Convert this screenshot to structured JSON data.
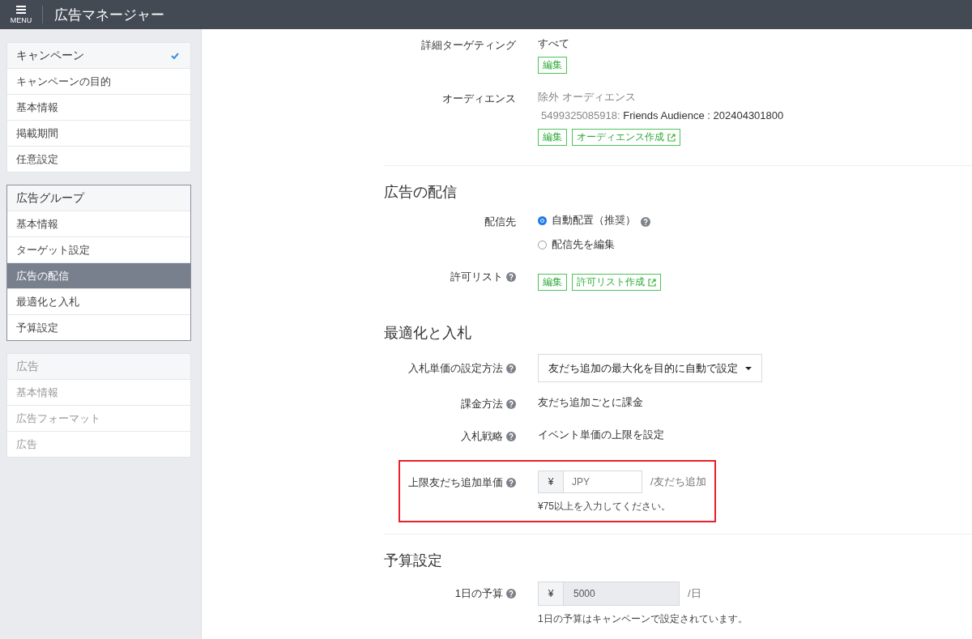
{
  "header": {
    "menu_label": "MENU",
    "title": "広告マネージャー"
  },
  "sidebar": {
    "groups": [
      {
        "title": "キャンペーン",
        "checked": true,
        "active": false,
        "disabled": false,
        "items": [
          {
            "label": "キャンペーンの目的",
            "selected": false
          },
          {
            "label": "基本情報",
            "selected": false
          },
          {
            "label": "掲載期間",
            "selected": false
          },
          {
            "label": "任意設定",
            "selected": false
          }
        ]
      },
      {
        "title": "広告グループ",
        "checked": false,
        "active": true,
        "disabled": false,
        "items": [
          {
            "label": "基本情報",
            "selected": false
          },
          {
            "label": "ターゲット設定",
            "selected": false
          },
          {
            "label": "広告の配信",
            "selected": true
          },
          {
            "label": "最適化と入札",
            "selected": false
          },
          {
            "label": "予算設定",
            "selected": false
          }
        ]
      },
      {
        "title": "広告",
        "checked": false,
        "active": false,
        "disabled": true,
        "items": [
          {
            "label": "基本情報",
            "selected": false
          },
          {
            "label": "広告フォーマット",
            "selected": false
          },
          {
            "label": "広告",
            "selected": false
          }
        ]
      }
    ]
  },
  "sections": [
    {
      "separated": false,
      "rows": [
        {
          "kind": "text",
          "label": "詳細ターゲティング",
          "help": false,
          "value": "すべて",
          "buttons": [
            {
              "label": "編集",
              "external": false
            }
          ]
        },
        {
          "kind": "audience",
          "label": "オーディエンス",
          "help": false,
          "muted_line": "除外 オーディエンス",
          "audience_id": "5499325085918:",
          "audience_name": "Friends Audience : 202404301800",
          "buttons": [
            {
              "label": "編集",
              "external": false
            },
            {
              "label": "オーディエンス作成",
              "external": true
            }
          ]
        }
      ]
    },
    {
      "separated": true,
      "heading": "広告の配信",
      "rows": [
        {
          "kind": "radio",
          "label": "配信先",
          "help": false,
          "options": [
            {
              "label": "自動配置（推奨）",
              "selected": true,
              "help": true
            },
            {
              "label": "配信先を編集",
              "selected": false,
              "help": false
            }
          ]
        },
        {
          "kind": "buttons",
          "label": "許可リスト",
          "help": true,
          "buttons": [
            {
              "label": "編集",
              "external": false
            },
            {
              "label": "許可リスト作成",
              "external": true
            }
          ]
        }
      ]
    },
    {
      "separated": false,
      "heading": "最適化と入札",
      "rows": [
        {
          "kind": "select",
          "label": "入札単価の設定方法",
          "help": true,
          "value": "友だち追加の最大化を目的に自動で設定"
        },
        {
          "kind": "text",
          "label": "課金方法",
          "help": true,
          "value": "友だち追加ごとに課金"
        },
        {
          "kind": "text",
          "label": "入札戦略",
          "help": true,
          "value": "イベント単価の上限を設定"
        },
        {
          "kind": "input",
          "label": "上限友だち追加単価",
          "help": true,
          "highlighted": true,
          "disabled": false,
          "prefix": "¥",
          "placeholder": "JPY",
          "suffix": "/友だち追加",
          "note": "¥75以上を入力してください。"
        }
      ]
    },
    {
      "separated": true,
      "heading": "予算設定",
      "rows": [
        {
          "kind": "input",
          "label": "1日の予算",
          "help": true,
          "highlighted": false,
          "disabled": true,
          "prefix": "¥",
          "value": "5000",
          "suffix": "/日",
          "note": "1日の予算はキャンペーンで設定されています。"
        }
      ]
    }
  ]
}
